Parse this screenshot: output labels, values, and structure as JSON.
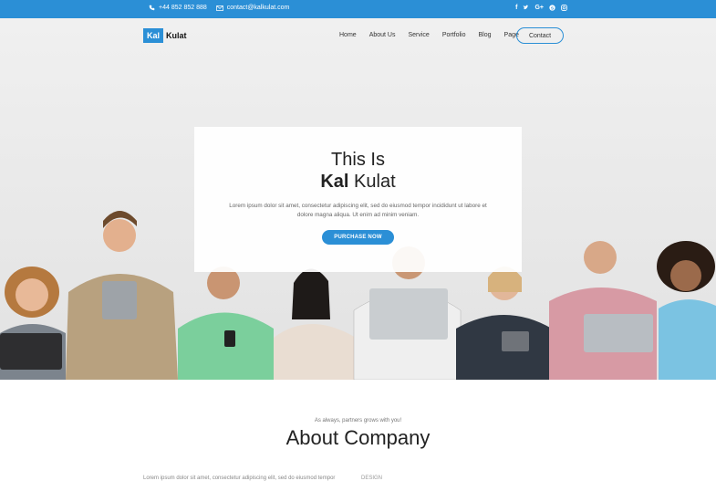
{
  "topbar": {
    "phone": "+44 852 852 888",
    "email": "contact@kalkulat.com",
    "socials": [
      "f",
      "twitter",
      "G+",
      "skype",
      "instagram"
    ]
  },
  "brand": {
    "kal": "Kal",
    "kulat": "Kulat"
  },
  "nav": {
    "items": [
      "Home",
      "About Us",
      "Service",
      "Portfolio",
      "Blog",
      "Page"
    ],
    "contact": "Contact"
  },
  "hero": {
    "line1": "This Is",
    "bold": "Kal",
    "rest": " Kulat",
    "text": "Lorem ipsum dolor sit amet, consectetur adipiscing elit, sed do eiusmod tempor incididunt ut labore et dolore magna aliqua. Ut enim ad minim veniam.",
    "button": "PURCHASE NOW"
  },
  "about": {
    "tagline": "As always, partners grows with you!",
    "title": "About Company",
    "para_start": "Lorem ipsum dolor sit amet, consectetur adipiscing elit, sed do eiusmod tempor",
    "stat_start": "DESIGN"
  },
  "colors": {
    "accent": "#2b8fd6"
  }
}
